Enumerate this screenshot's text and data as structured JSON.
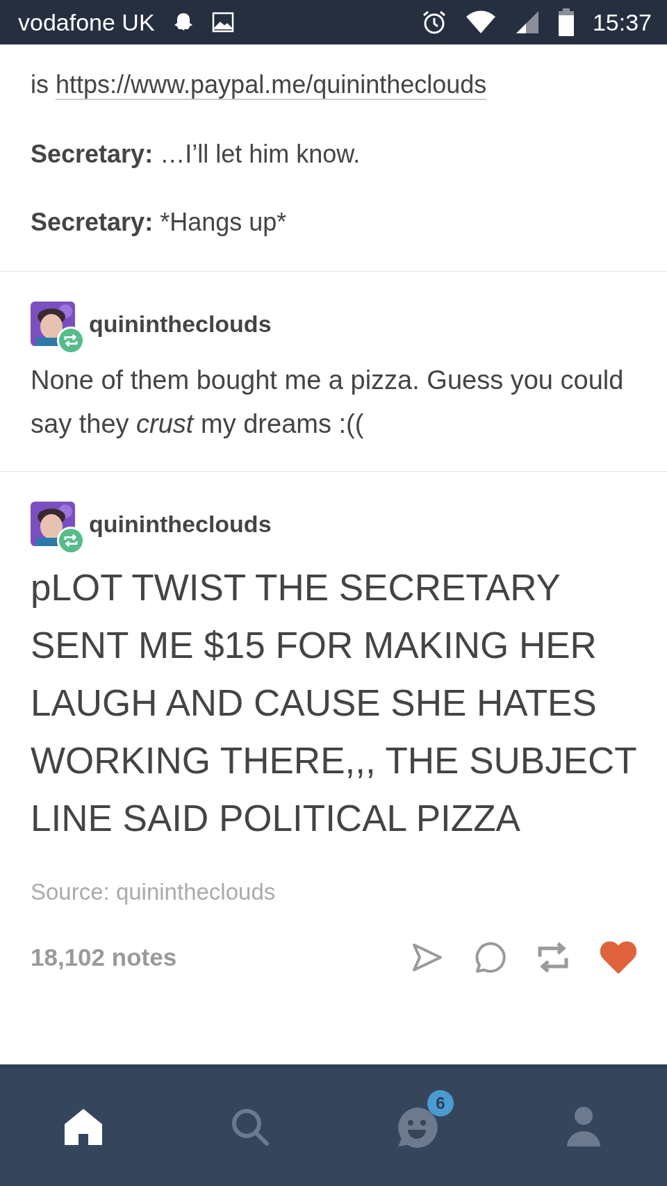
{
  "status_bar": {
    "carrier": "vodafone UK",
    "time": "15:37"
  },
  "top_post": {
    "lead": "is",
    "link": "https://www.paypal.me/quinintheclouds",
    "lines": [
      {
        "speaker": "Secretary:",
        "text": "…I’ll let him know."
      },
      {
        "speaker": "Secretary:",
        "text": "*Hangs up*"
      }
    ]
  },
  "reblogs": [
    {
      "username": "quinintheclouds",
      "text": "None of them bought me a pizza. Guess you could say they *crust* my dreams :((",
      "kind": "normal"
    },
    {
      "username": "quinintheclouds",
      "text": "pLOT TWIST THE SECRETARY SENT ME $15 FOR MAKING HER LAUGH AND CAUSE SHE HATES WORKING THERE,,, THE SUBJECT LINE SAID POLITICAL PIZZA",
      "kind": "large"
    }
  ],
  "footer": {
    "source": "Source: quinintheclouds",
    "notes": "18,102 notes",
    "liked": true
  },
  "nav": [
    {
      "kind": "home",
      "selected": true
    },
    {
      "kind": "search",
      "selected": false
    },
    {
      "kind": "activity",
      "selected": false,
      "badge": "6"
    },
    {
      "kind": "account",
      "selected": false
    }
  ]
}
